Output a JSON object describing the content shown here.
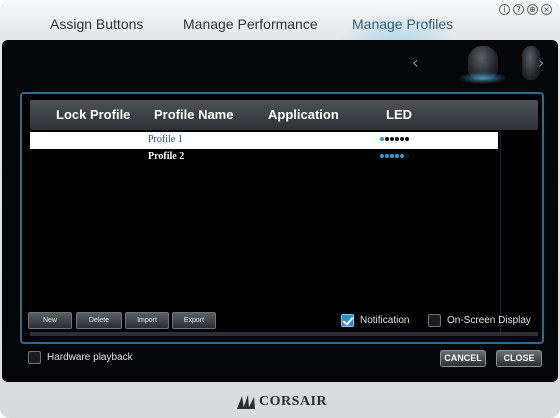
{
  "window": {
    "controls": [
      {
        "name": "info-icon",
        "glyph": "i"
      },
      {
        "name": "help-icon",
        "glyph": "?"
      },
      {
        "name": "globe-icon",
        "glyph": "⊕"
      },
      {
        "name": "close-icon",
        "glyph": "×"
      }
    ]
  },
  "tabs": [
    {
      "label": "Assign Buttons",
      "active": false
    },
    {
      "label": "Manage Performance",
      "active": false
    },
    {
      "label": "Manage Profiles",
      "active": true
    }
  ],
  "devices": {
    "prev_glyph": "‹",
    "next_glyph": "›",
    "items": [
      {
        "name": "mouse-device-icon",
        "selected": true
      },
      {
        "name": "mouse-device-icon-2",
        "selected": false
      }
    ]
  },
  "table": {
    "headers": [
      "Lock Profile",
      "Profile Name",
      "Application",
      "LED"
    ],
    "rows": [
      {
        "name": "Profile 1",
        "selected": true,
        "led_on": [
          true,
          false,
          false,
          false,
          false,
          false
        ]
      },
      {
        "name": "Profile 2",
        "selected": false,
        "led_on": [
          true,
          true,
          true,
          true,
          true,
          false
        ]
      }
    ]
  },
  "actions": {
    "new_label": "New",
    "delete_label": "Delete",
    "import_label": "Import",
    "export_label": "Export"
  },
  "options": {
    "notification_label": "Notification",
    "notification_checked": true,
    "osd_label": "On-Screen Display",
    "osd_checked": false,
    "hardware_playback_label": "Hardware playback",
    "hardware_playback_checked": false
  },
  "dialog": {
    "cancel_label": "CANCEL",
    "close_label": "CLOSE"
  },
  "brand": {
    "logo_text": "CORSAIR",
    "accent_color": "#2a9bd6"
  }
}
